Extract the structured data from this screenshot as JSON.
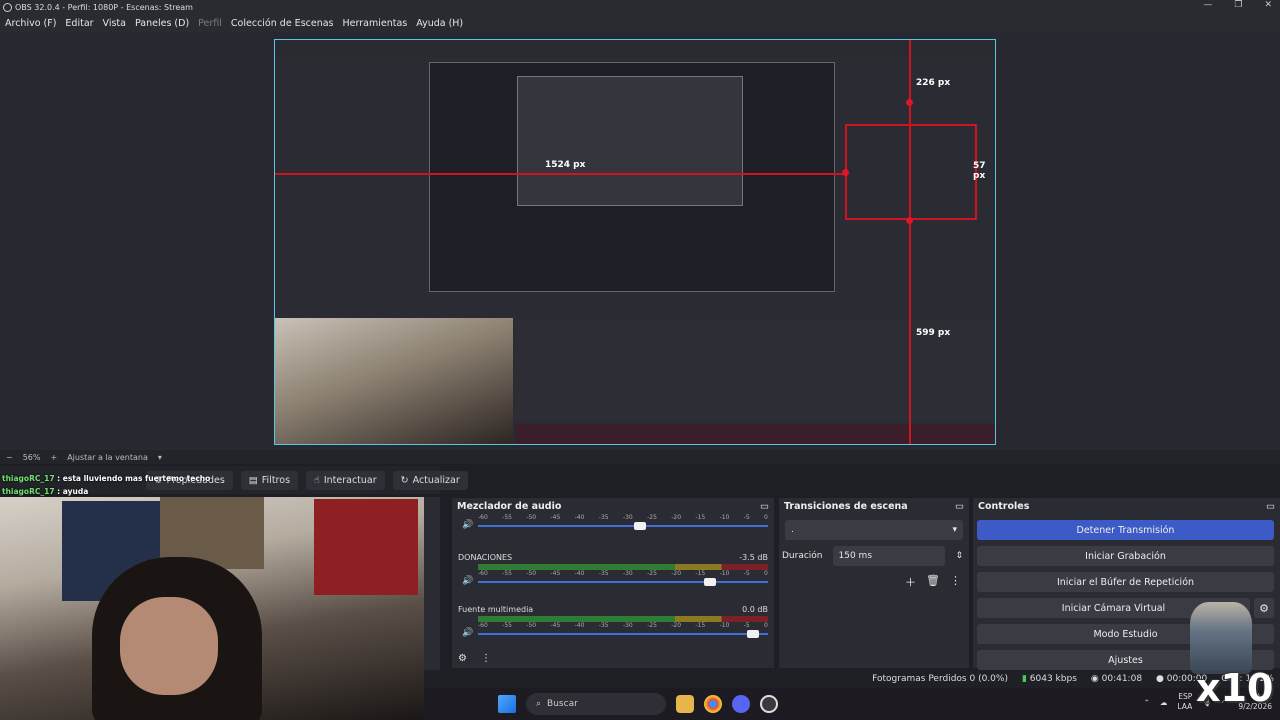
{
  "window": {
    "title": "OBS 32.0.4 - Perfil: 1080P - Escenas: Stream",
    "controls": [
      "—",
      "❐",
      "✕"
    ]
  },
  "menu": [
    {
      "label": "Archivo (F)",
      "enabled": true
    },
    {
      "label": "Editar",
      "enabled": true
    },
    {
      "label": "Vista",
      "enabled": true
    },
    {
      "label": "Paneles (D)",
      "enabled": true
    },
    {
      "label": "Perfil",
      "enabled": false
    },
    {
      "label": "Colección de Escenas",
      "enabled": true
    },
    {
      "label": "Herramientas",
      "enabled": true
    },
    {
      "label": "Ayuda (H)",
      "enabled": true
    }
  ],
  "preview": {
    "measurements": {
      "top": "226 px",
      "right": "57 px",
      "left": "1524 px",
      "bottom": "599 px"
    },
    "zoom": "56%",
    "fit_label": "Ajustar a la ventana",
    "zoom_minus": "−",
    "zoom_plus": "+"
  },
  "source_toolbar": {
    "properties": "Propiedades",
    "filters": "Filtros",
    "interact": "Interactuar",
    "refresh": "Actualizar"
  },
  "chat": [
    {
      "user": "thiagoRC_17",
      "message": ": esta lluviendo mas fuertemo techo"
    },
    {
      "user": "thiagoRC_17",
      "message": ": ayuda"
    }
  ],
  "mixer": {
    "title": "Mezclador de audio",
    "ticks": [
      "-60",
      "-55",
      "-50",
      "-45",
      "-40",
      "-35",
      "-30",
      "-25",
      "-20",
      "-15",
      "-10",
      "-5",
      "0"
    ],
    "channels": [
      {
        "name": "",
        "db": "",
        "level": 0.58
      },
      {
        "name": "DONACIONES",
        "db": "-3.5 dB",
        "level": 0.82
      },
      {
        "name": "Fuente multimedia",
        "db": "0.0 dB",
        "level": 0.97
      }
    ]
  },
  "transitions": {
    "title": "Transiciones de escena",
    "selected": ".",
    "duration_label": "Duración",
    "duration_value": "150 ms"
  },
  "controls": {
    "title": "Controles",
    "stop_stream": "Detener Transmisión",
    "start_recording": "Iniciar Grabación",
    "start_replay": "Iniciar el Búfer de Repetición",
    "start_virtual_cam": "Iniciar Cámara Virtual",
    "studio_mode": "Modo Estudio",
    "settings": "Ajustes"
  },
  "status": {
    "dropped_frames": "Fotogramas Perdidos 0 (0.0%)",
    "bitrate": "6043 kbps",
    "stream_time": "00:41:08",
    "rec_time": "00:00:00",
    "cpu": "CPU: 12.2%"
  },
  "taskbar": {
    "search_placeholder": "Buscar",
    "lang": "ESP",
    "lang2": "LAA",
    "time": "0:41",
    "date": "9/2/2026"
  },
  "overlay_text": "x10",
  "colors": {
    "accent": "#3d5bc7",
    "measure_red": "#d0141f",
    "selection_cyan": "#57c7e6",
    "chat_user": "#6fe26f"
  }
}
